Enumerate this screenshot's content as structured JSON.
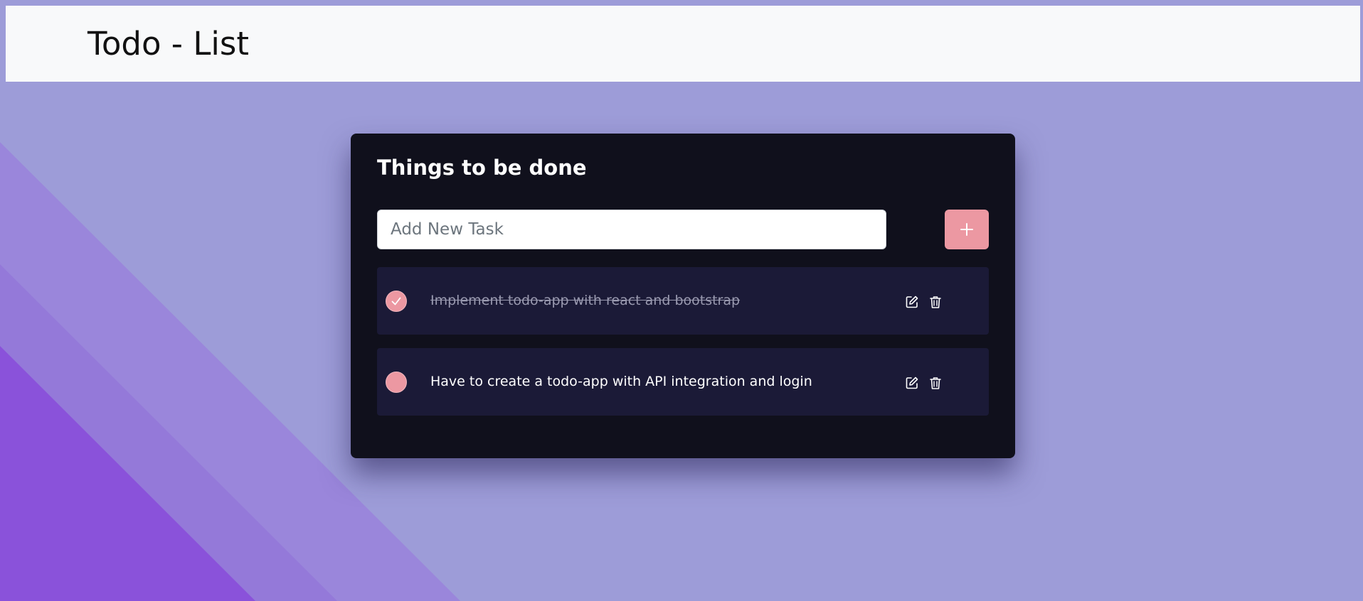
{
  "navbar": {
    "brand": "Todo - List"
  },
  "card": {
    "title": "Things to be done",
    "input": {
      "placeholder": "Add New Task",
      "value": ""
    },
    "add_button_icon": "plus-icon"
  },
  "tasks": [
    {
      "text": "Implement todo-app with react and bootstrap",
      "completed": true
    },
    {
      "text": "Have to create a todo-app with API integration and login",
      "completed": false
    }
  ],
  "icons": {
    "check": "check-icon",
    "edit": "edit-icon",
    "delete": "trash-icon"
  },
  "colors": {
    "background": "#9d9cd8",
    "navbar": "#f8f9fa",
    "card": "#10101c",
    "task_row": "#1b1a37",
    "accent": "#ec98a2",
    "diagonal_bands": [
      "#9a86db",
      "#9479d9",
      "#8a52da"
    ]
  }
}
